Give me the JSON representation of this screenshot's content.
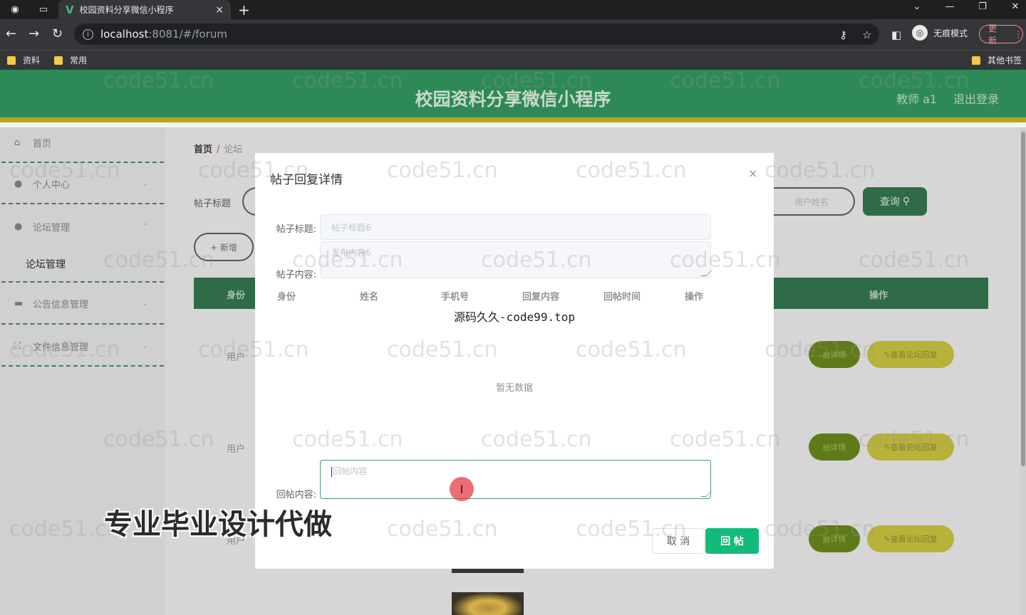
{
  "browser": {
    "tab_title": "校园资料分享微信小程序",
    "tab_close": "×",
    "new_tab": "+",
    "url_host": "localhost",
    "url_path": ":8081/#/forum",
    "incognito_label": "无痕模式",
    "update_label": "更新",
    "bookmarks": [
      "资料",
      "常用"
    ],
    "other_bookmarks": "其他书签"
  },
  "header": {
    "site_title": "校园资料分享微信小程序",
    "user": "教师 a1",
    "logout": "退出登录"
  },
  "sidebar": {
    "items": [
      {
        "label": "首页",
        "icon": "home-icon"
      },
      {
        "label": "个人中心",
        "icon": "user-icon"
      },
      {
        "label": "论坛管理",
        "icon": "user-icon"
      },
      {
        "label": "公告信息管理",
        "icon": "briefcase-icon"
      },
      {
        "label": "文件信息管理",
        "icon": "file-icon"
      }
    ],
    "sub_item": "论坛管理"
  },
  "main": {
    "breadcrumb_home": "首页",
    "breadcrumb_sep": "/",
    "breadcrumb_current": "论坛",
    "search_label": "帖子标题",
    "user_placeholder": "用户姓名",
    "query_button": "查询",
    "add_button": "+ 新增",
    "col_role": "身份",
    "col_action": "操作",
    "rows": [
      {
        "role": "用户",
        "detail": "详情",
        "view_reply": "查看论坛回复"
      },
      {
        "role": "用户",
        "detail": "详情",
        "view_reply": "查看论坛回复"
      },
      {
        "role": "用户",
        "detail": "详情",
        "view_reply": "查看论坛回复"
      }
    ]
  },
  "modal": {
    "title": "帖子回复详情",
    "close": "×",
    "post_title_label": "帖子标题:",
    "post_title_value": "帖子标题6",
    "post_content_label": "帖子内容:",
    "post_content_value": "发布内容6",
    "columns": [
      "身份",
      "姓名",
      "手机号",
      "回复内容",
      "回帖时间",
      "操作"
    ],
    "watermark_line": "源码久久-code99.top",
    "empty_text": "暂无数据",
    "reply_label": "回帖内容:",
    "reply_placeholder": "回帖内容",
    "cancel_button": "取 消",
    "submit_button": "回 帖"
  },
  "overlay_text": {
    "watermark": "code51.cn",
    "promo": "专业毕业设计代做"
  },
  "colors": {
    "header_green": "#2d8a57",
    "accent_green": "#13bb7a",
    "header_yellow_bar": "#b8a81c"
  }
}
